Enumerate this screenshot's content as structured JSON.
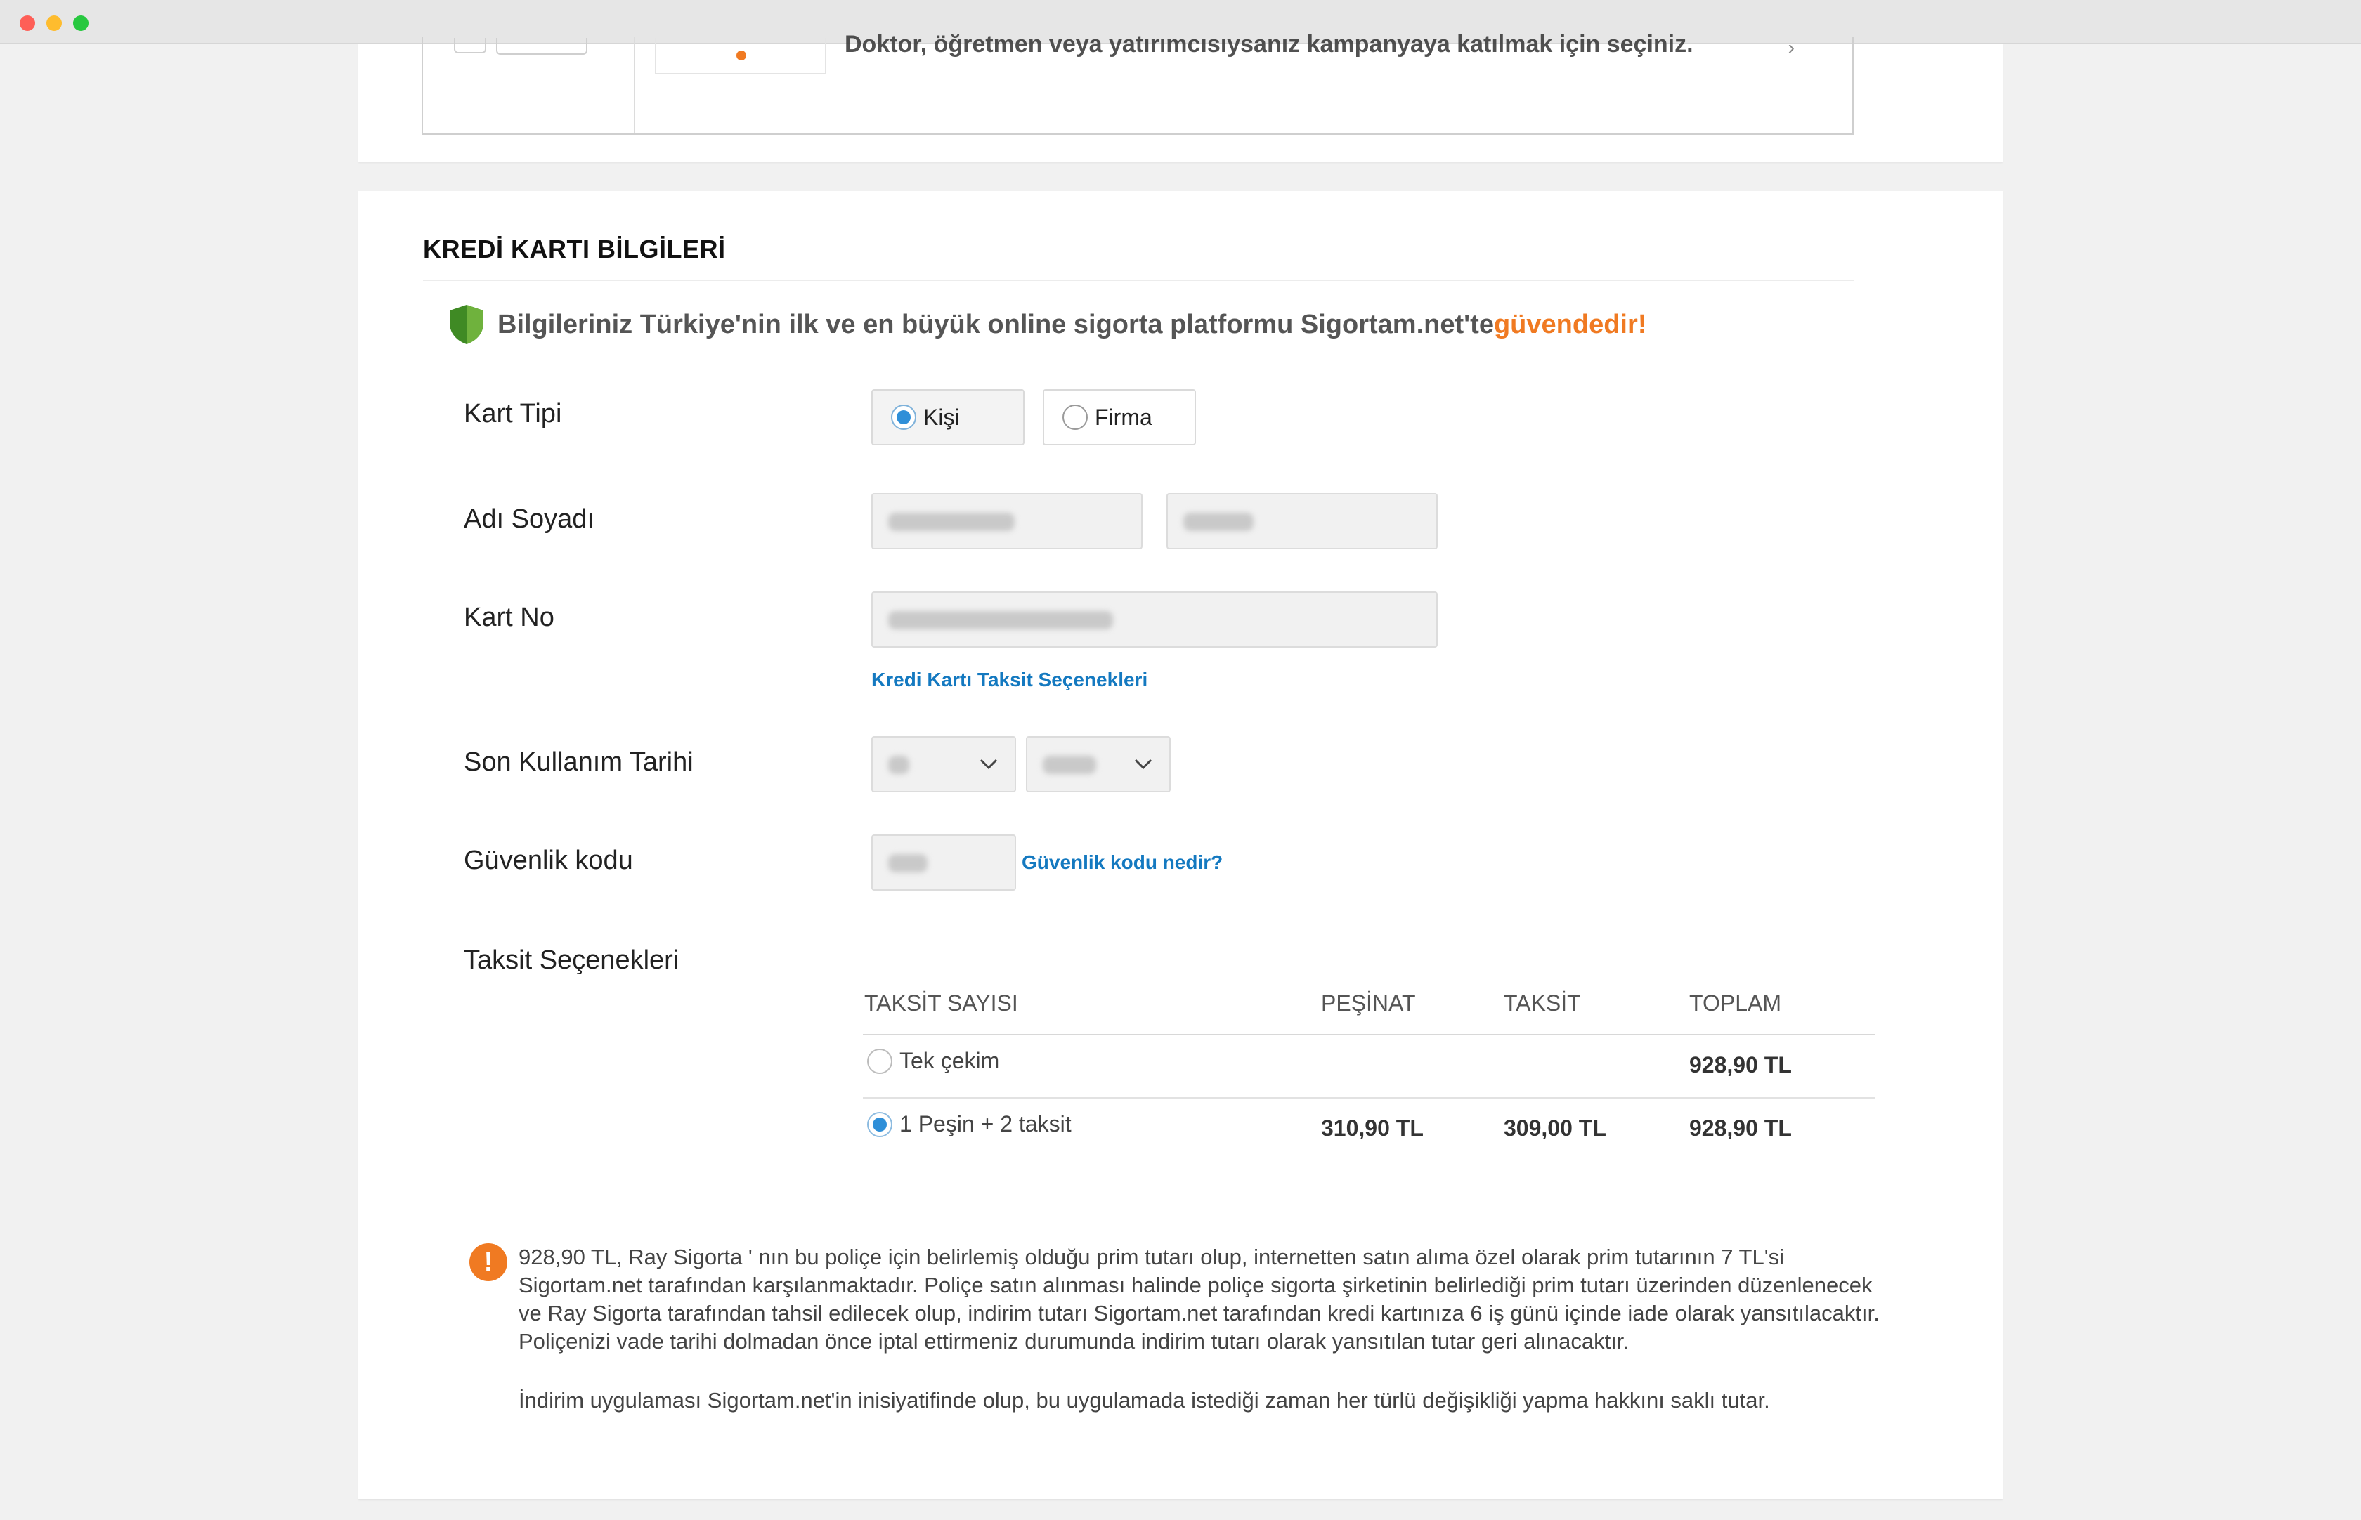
{
  "previous_card": {
    "text": "Doktor, öğretmen veya yatırımcısıysanız kampanyaya katılmak için seçiniz."
  },
  "section": {
    "title": "KREDİ KARTI BİLGİLERİ",
    "secure_text": "Bilgileriniz Türkiye'nin ilk ve en büyük online sigorta platformu Sigortam.net'te ",
    "secure_accent": "güvendedir!"
  },
  "form": {
    "card_type": {
      "label": "Kart Tipi",
      "options": [
        "Kişi",
        "Firma"
      ],
      "selected": "Kişi"
    },
    "name": {
      "label": "Adı Soyadı"
    },
    "card_no": {
      "label": "Kart No",
      "installment_link": "Kredi Kartı Taksit Seçenekleri"
    },
    "expiry": {
      "label": "Son Kullanım Tarihi"
    },
    "cvv": {
      "label": "Güvenlik kodu",
      "help_link": "Güvenlik kodu nedir?"
    },
    "installments": {
      "label": "Taksit Seçenekleri",
      "headers": [
        "TAKSİT SAYISI",
        "PEŞİNAT",
        "TAKSİT",
        "TOPLAM"
      ],
      "rows": [
        {
          "label": "Tek çekim",
          "down_payment": "",
          "installment": "",
          "total": "928,90 TL",
          "selected": false
        },
        {
          "label": "1 Peşin + 2 taksit",
          "down_payment": "310,90 TL",
          "installment": "309,00 TL",
          "total": "928,90 TL",
          "selected": true
        }
      ]
    }
  },
  "notice": {
    "paragraph1": "928,90 TL, Ray Sigorta ' nın bu poliçe için belirlemiş olduğu prim tutarı olup, internetten satın alıma özel olarak prim tutarının 7 TL'si Sigortam.net tarafından karşılanmaktadır. Poliçe satın alınması halinde poliçe sigorta şirketinin belirlediği prim tutarı üzerinden düzenlenecek ve Ray Sigorta tarafından tahsil edilecek olup, indirim tutarı Sigortam.net tarafından kredi kartınıza 6 iş günü içinde iade olarak yansıtılacaktır. Poliçenizi vade tarihi dolmadan önce iptal ettirmeniz durumunda indirim tutarı olarak yansıtılan tutar geri alınacaktır.",
    "paragraph2": "İndirim uygulaması Sigortam.net'in inisiyatifinde olup, bu uygulamada istediği zaman her türlü değişikliği yapma hakkını saklı tutar."
  },
  "colors": {
    "accent_orange": "#f07a22",
    "link_blue": "#1479c0",
    "radio_blue": "#2f8fd8",
    "shield_green": "#4e9a2e"
  }
}
